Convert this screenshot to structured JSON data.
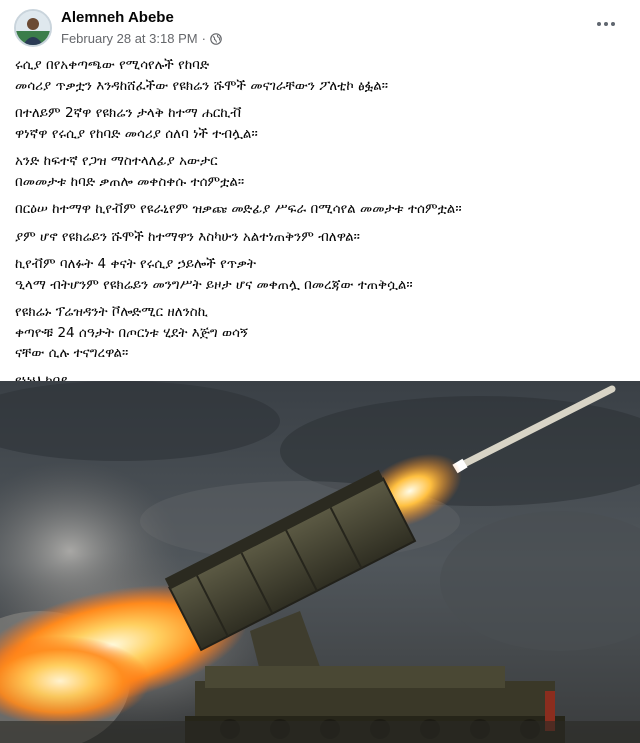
{
  "post": {
    "author": "Alemneh Abebe",
    "date": "February 28 at 3:18 PM",
    "separator": "·",
    "privacy_icon": "globe-icon",
    "more_icon": "more-horizontal-icon",
    "paragraphs": [
      [
        "ሩሲያ በየአቀጣጫው የሚሳየሉች የከባድ",
        "መሳሪያ ጥቃቷን እንዳከሸፈችው የዩክሬን ሹሞች መናገራቸውን ፖለቲኮ ፅፏል።"
      ],
      [
        "በተለይም 2ኛዋ የዩክሬን ታላቅ ከተማ ሐርኪቭ",
        "ዋነኛዋ የሩሲያ የከባድ መሳሪያ ሰለባ ነች ተብሏል።"
      ],
      [
        "አንድ ከፍተኛ የጋዝ ማስተላለፊያ አውታር",
        "በመመታቱ ከባድ ቃጠሎ መቀስቀሱ ተሰምቷል።"
      ],
      [
        "በርዕሠ ከተማዋ ኪየቭም የዩራኒየም ዝቃጩ መድፊያ ሥፍራ በሚሳየል መመታቱ ተሰምቷል።"
      ],
      [
        "ያም ሆኖ የዩክሬይን ሹሞች ከተማዋን እስካሁን አልተነጠቅንም ብለዋል።"
      ],
      [
        "ኪየቭም ባለፉት 4 ቀናት የሩሲያ ኃይሎች የጥቃት",
        "ዒላማ ብትሆንም የዩክሬይን መንግሥት ይዞታ ሆና መቀጠሏ በመረጃው ተጠቅሷል።"
      ],
      [
        "የዩክሬኑ ፕሬዝዳንት ቮሎድሚር ዘለንስኪ",
        "ቀጣዮቹ 24 ሰዓታት በጦርነቱ ሂደት እጅግ ወሳኝ",
        "ናቸው ሲሉ ተናግረዋል።"
      ],
      [
        "የኔነህ ከበደ"
      ]
    ]
  },
  "colors": {
    "text": "#050505",
    "meta": "#65676b",
    "background": "#ffffff"
  }
}
